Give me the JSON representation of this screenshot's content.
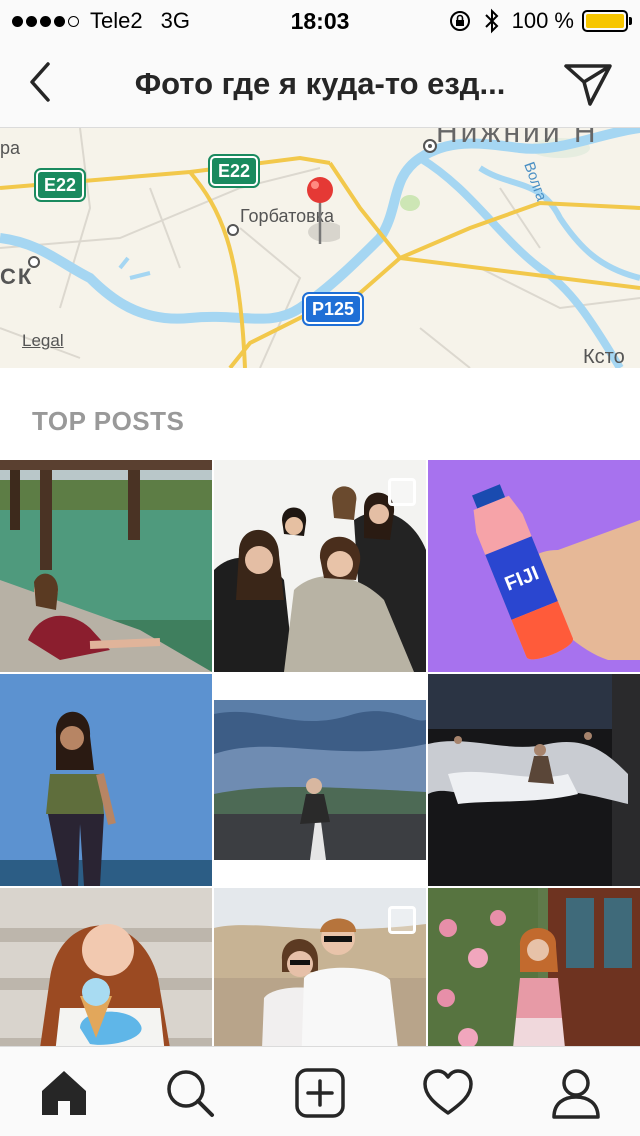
{
  "status_bar": {
    "carrier": "Tele2",
    "network": "3G",
    "time": "18:03",
    "battery_percent": "100 %",
    "battery_level": 1.0,
    "battery_color": "#f7c600"
  },
  "nav": {
    "title": "Фото где я куда-то езд...",
    "back_icon": "chevron-left-icon",
    "send_icon": "paper-plane-icon"
  },
  "map": {
    "labels": {
      "top_left": "ра",
      "gorbatovka": "Горбатовка",
      "volga": "Волга",
      "left_city": "ск",
      "bottom_right": "Ксто",
      "top_city": "Нижний Н"
    },
    "road_badges": [
      "E22",
      "E22",
      "P125"
    ],
    "legal": "Legal",
    "pin_color": "#e53935"
  },
  "section": {
    "title": "TOP POSTS"
  },
  "posts": [
    {
      "name": "post-girl-in-pool",
      "multi": false
    },
    {
      "name": "post-group-of-girls",
      "multi": true
    },
    {
      "name": "post-fiji-bottle",
      "multi": false
    },
    {
      "name": "post-girl-blue-sky",
      "multi": false
    },
    {
      "name": "post-girl-on-road",
      "multi": false
    },
    {
      "name": "post-sea-waves",
      "multi": false
    },
    {
      "name": "post-girl-ice-cream",
      "multi": false
    },
    {
      "name": "post-couple",
      "multi": true
    },
    {
      "name": "post-girl-roses",
      "multi": false
    }
  ],
  "tab_bar": {
    "items": [
      "home-icon",
      "search-icon",
      "add-post-icon",
      "heart-icon",
      "profile-icon"
    ],
    "active": "home-icon"
  }
}
